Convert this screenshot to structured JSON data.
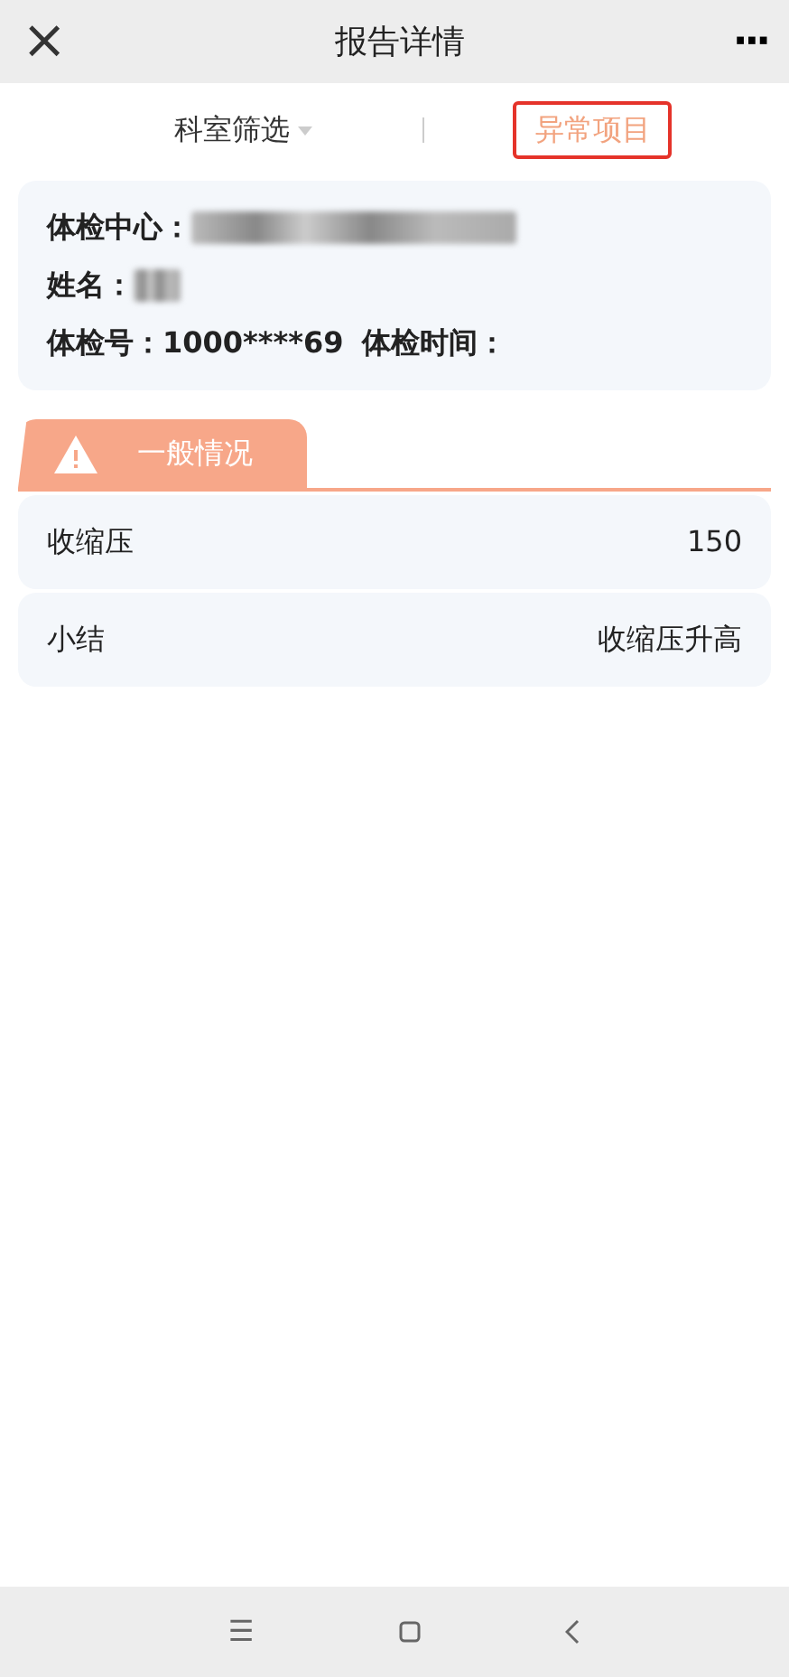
{
  "header": {
    "close": "×",
    "title": "报告详情",
    "more": "···"
  },
  "filters": [
    {
      "label": "科室筛选",
      "kind": "dropdown",
      "selected": false,
      "annotated": false
    },
    {
      "label": "异常项目",
      "kind": "toggle",
      "selected": true,
      "annotated": true
    }
  ],
  "info": [
    {
      "label": "体检中心：",
      "redacted": true
    },
    {
      "label": "姓名：",
      "redacted": true
    },
    {
      "label": "体检号：1000****69",
      "redacted": false
    },
    {
      "label": "体检时间：",
      "redacted": false
    }
  ],
  "section": {
    "title": "一般情况"
  },
  "rows": [
    {
      "name": "收缩压",
      "value": "150"
    },
    {
      "name": "小结",
      "value": "收缩压升高"
    }
  ],
  "nav_bar": {
    "menu": "☰"
  }
}
